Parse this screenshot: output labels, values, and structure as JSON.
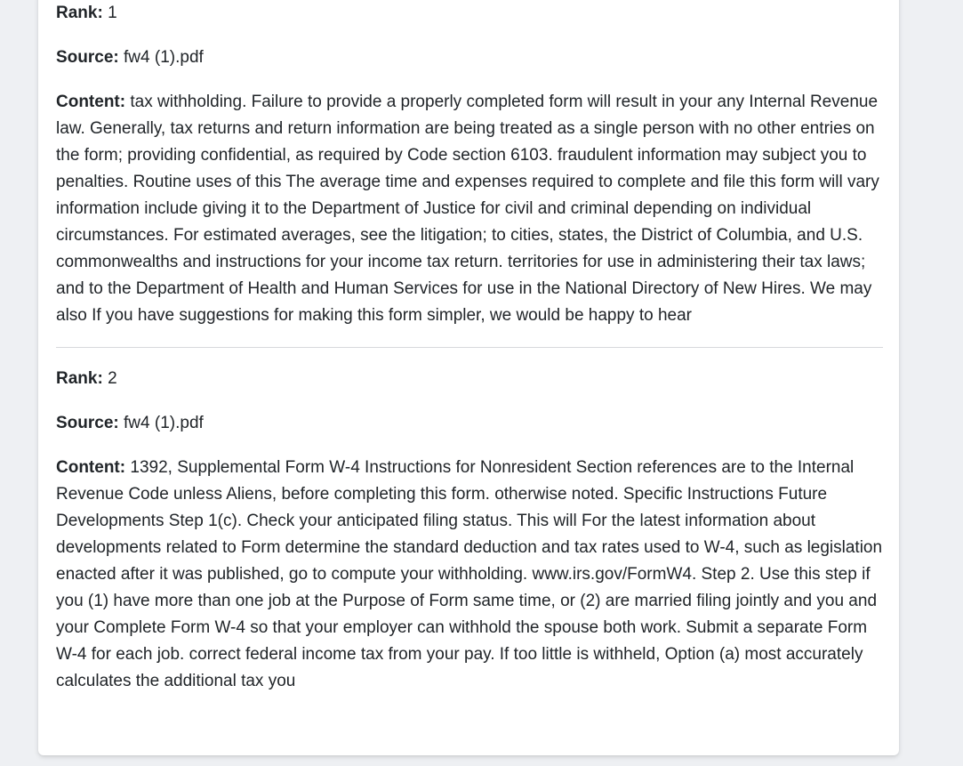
{
  "results": [
    {
      "rank_label": "Rank:",
      "rank_value": "1",
      "source_label": "Source:",
      "source_value": "fw4 (1).pdf",
      "content_label": "Content:",
      "content_value": "tax withholding. Failure to provide a properly completed form will result in your any Internal Revenue law. Generally, tax returns and return information are being treated as a single person with no other entries on the form; providing confidential, as required by Code section 6103. fraudulent information may subject you to penalties. Routine uses of this The average time and expenses required to complete and file this form will vary information include giving it to the Department of Justice for civil and criminal depending on individual circumstances. For estimated averages, see the litigation; to cities, states, the District of Columbia, and U.S. commonwealths and instructions for your income tax return. territories for use in administering their tax laws; and to the Department of Health and Human Services for use in the National Directory of New Hires. We may also If you have suggestions for making this form simpler, we would be happy to hear"
    },
    {
      "rank_label": "Rank:",
      "rank_value": "2",
      "source_label": "Source:",
      "source_value": "fw4 (1).pdf",
      "content_label": "Content:",
      "content_value": "1392, Supplemental Form W-4 Instructions for Nonresident Section references are to the Internal Revenue Code unless Aliens, before completing this form. otherwise noted. Specific Instructions Future Developments Step 1(c). Check your anticipated filing status. This will For the latest information about developments related to Form determine the standard deduction and tax rates used to W-4, such as legislation enacted after it was published, go to compute your withholding. www.irs.gov/FormW4. Step 2. Use this step if you (1) have more than one job at the Purpose of Form same time, or (2) are married filing jointly and you and your Complete Form W-4 so that your employer can withhold the spouse both work. Submit a separate Form W-4 for each job. correct federal income tax from your pay. If too little is withheld, Option (a) most accurately calculates the additional tax you"
    }
  ]
}
